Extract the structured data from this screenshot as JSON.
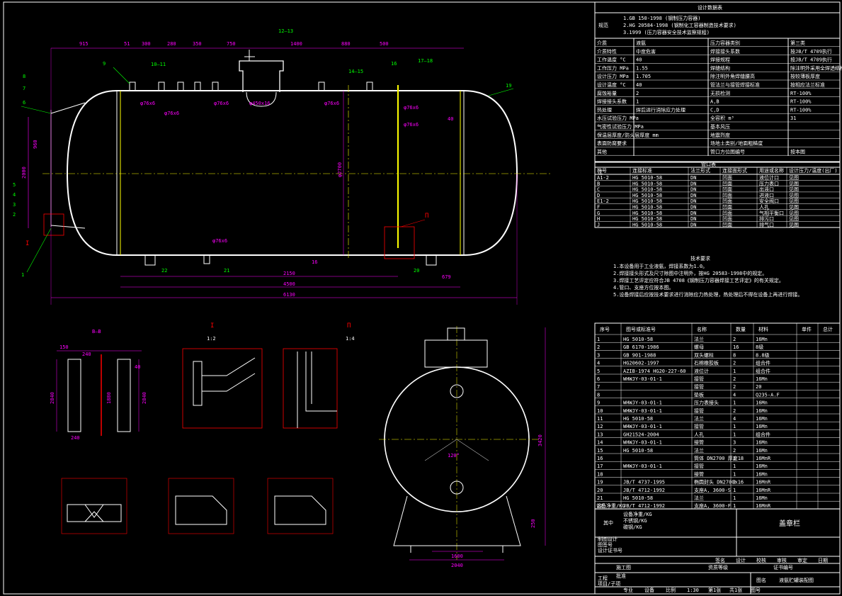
{
  "design_data": {
    "title": "设计数据表",
    "spec_label": "规范",
    "specs": [
      "1.GB 150-1998 (钢制压力容器)",
      "2.HG 20584-1998 (钢制化工容器制造技术要求)",
      "3.1999 (压力容器安全技术监察规程)"
    ],
    "rows": [
      [
        "介质",
        "液氨",
        "压力容器类别",
        "第三类"
      ],
      [
        "介质特性",
        "中度危害",
        "焊接接头系数",
        "按JB/T 4709执行"
      ],
      [
        "工作温度 °C",
        "40",
        "焊接规程",
        "按JB/T 4709执行"
      ],
      [
        "工作压力 MPa",
        "1.55",
        "焊缝结构",
        "除注明外采用全焊透结构"
      ],
      [
        "设计压力 MPa",
        "1.705",
        "除注明外角焊缝腰高",
        "按较薄板厚度"
      ],
      [
        "设计温度 °C",
        "40",
        "管法兰与接管焊接标准",
        "按相应法兰标准"
      ],
      [
        "腐蚀裕量",
        "2",
        "无损检测",
        "RT-100%"
      ],
      [
        "焊接接头系数",
        "1",
        "A,B",
        "RT-100%"
      ],
      [
        "热处理",
        "焊后进行消除应力处理",
        "C,D",
        "RT-100%"
      ],
      [
        "水压试验压力 MPa",
        "",
        "全容积 m³",
        "31"
      ],
      [
        "气密性试验压力 MPa",
        "",
        "基本风压",
        ""
      ],
      [
        "保温层厚度/防火层厚度 mm",
        "",
        "地震烈度",
        ""
      ],
      [
        "表面防腐要求",
        "",
        "场地土类别/地面粗糙度",
        ""
      ],
      [
        "其他",
        "",
        "管口方位图编号",
        "按本图"
      ]
    ]
  },
  "note_label": "注",
  "nozzle_table": {
    "title": "管口表",
    "headers": [
      "符号",
      "连接标准",
      "法兰形式",
      "连接面形式",
      "用途或名称",
      "设计压力/温度(出厂)"
    ],
    "rows": [
      [
        "A1-2",
        "HG 5010-58",
        "DN",
        "凹面",
        "液位计口",
        "见图"
      ],
      [
        "B",
        "HG 5010-58",
        "DN",
        "凹面",
        "压力表口",
        "见图"
      ],
      [
        "C",
        "HG 5010-58",
        "DN",
        "凹面",
        "出液口",
        "见图"
      ],
      [
        "D",
        "HG 5010-58",
        "DN",
        "凹面",
        "进液口",
        "见图"
      ],
      [
        "E1-2",
        "HG 5010-58",
        "DN",
        "凹面",
        "安全阀口",
        "见图"
      ],
      [
        "F",
        "HG 5010-58",
        "DN",
        "凹面",
        "人孔",
        "见图"
      ],
      [
        "G",
        "HG 5010-58",
        "DN",
        "凹面",
        "气相平衡口",
        "见图"
      ],
      [
        "H",
        "HG 5010-58",
        "DN",
        "凹面",
        "排污口",
        "见图"
      ],
      [
        "J",
        "HG 5010-58",
        "DN",
        "凹面",
        "排气口",
        "见图"
      ]
    ]
  },
  "tech_req": {
    "title": "技术要求",
    "items": [
      "1.本设备用于工业液氨，焊接系数为1.0。",
      "2.焊接接头形式及尺寸除图中注明外，按HG 20583-1998中的规定。",
      "3.焊接工艺评定应符合JB 4708《钢制压力容器焊接工艺评定》的有关规定。",
      "4.管口、支座方位按本图。",
      "5.设备焊接后应按技术要求进行消除应力热处理，热处理后不得在设备上再进行焊接。"
    ]
  },
  "parts_table": {
    "headers": [
      "序号",
      "图号或标准号",
      "名称",
      "数量",
      "材料",
      "单件",
      "总计"
    ],
    "rows": [
      [
        "1",
        "HG 5010-58",
        "法兰",
        "2",
        "16Mn",
        "",
        ""
      ],
      [
        "2",
        "GB 6170-1986",
        "螺母",
        "16",
        "8级",
        "",
        ""
      ],
      [
        "3",
        "GB 901-1988",
        "双头螺柱",
        "8",
        "8.8级",
        "",
        ""
      ],
      [
        "4",
        "HG20602-1997",
        "石棉橡胶板",
        "2",
        "组合件",
        "",
        ""
      ],
      [
        "5",
        "AZIB-1974 HG20-227-60",
        "液位计",
        "1",
        "组合件",
        "",
        ""
      ],
      [
        "6",
        "WHWJY-03-01-1",
        "接管",
        "2",
        "16Mn",
        "",
        ""
      ],
      [
        "7",
        "",
        "接管",
        "2",
        "20",
        "",
        ""
      ],
      [
        "8",
        "",
        "垫板",
        "4",
        "Q235-A.F",
        "",
        ""
      ],
      [
        "9",
        "WHWJY-03-01-1",
        "压力表接头",
        "1",
        "16Mn",
        "",
        ""
      ],
      [
        "10",
        "WHWJY-03-01-1",
        "接管",
        "2",
        "16Mn",
        "",
        ""
      ],
      [
        "11",
        "HG 5010-58",
        "法兰",
        "4",
        "16Mn",
        "",
        ""
      ],
      [
        "12",
        "WHWJY-03-01-1",
        "接管",
        "1",
        "16Mn",
        "",
        ""
      ],
      [
        "13",
        "GH21524-2004",
        "人孔",
        "1",
        "组合件",
        "",
        ""
      ],
      [
        "14",
        "WHWJY-03-01-1",
        "接管",
        "3",
        "16Mn",
        "",
        ""
      ],
      [
        "15",
        "HG 5010-58",
        "法兰",
        "2",
        "16Mn",
        "",
        ""
      ],
      [
        "16",
        "",
        "筒体 DN2700 厚度18",
        "1",
        "16MnR",
        "",
        ""
      ],
      [
        "17",
        "WHWJY-03-01-1",
        "接管",
        "1",
        "16Mn",
        "",
        ""
      ],
      [
        "18",
        "",
        "接管",
        "1",
        "16Mn",
        "",
        ""
      ],
      [
        "19",
        "JB/T 4737-1995",
        "椭圆封头 DN2700x16",
        "2",
        "16MnR",
        "",
        ""
      ],
      [
        "20",
        "JB/T 4712-1992",
        "支座A, 3600-S",
        "1",
        "16MnR",
        "",
        ""
      ],
      [
        "21",
        "HG 5010-58",
        "法兰",
        "1",
        "16Mn",
        "",
        ""
      ],
      [
        "22",
        "JB/T 4712-1992",
        "支座A, 3600-F",
        "1",
        "16MnR",
        "",
        ""
      ]
    ]
  },
  "title_block": {
    "weight_label": "设备净重/KG",
    "weight_rows": [
      "设备净重/KG",
      "不锈钢/KG",
      "碳钢/KG"
    ],
    "among_label": "其中",
    "stamp": "盖章栏",
    "left_rows": [
      "制图设计",
      "图签号",
      "设计证书号"
    ],
    "sign_headers": [
      "签名",
      "设计",
      "校核",
      "审核",
      "审定",
      "日期"
    ],
    "company": "施工图",
    "approve": "批准",
    "project_stage": "资质等级",
    "cert_no": "证书编号",
    "name_label": "图名",
    "drawing_name": "液氨贮罐装配图",
    "project_label": "工程",
    "project_no": "项目/子项",
    "bottom": [
      "专业",
      "设备",
      "比例",
      "1:30",
      "第1张",
      "共1张",
      "图号"
    ]
  },
  "dims": {
    "top": [
      "915",
      "51",
      "300",
      "280",
      "350",
      "750",
      "1400",
      "880",
      "500"
    ],
    "d2150": "2150",
    "d4500": "4500",
    "d6130": "6130",
    "d960": "960",
    "d2000": "2000",
    "d2700": "φ2700",
    "d450": "φ450x16",
    "d76": "φ76x6",
    "d40": "40",
    "d679": "679",
    "d16": "16",
    "d3420": "3420",
    "d1600": "1600",
    "d2040": "2040",
    "d250": "250",
    "a120": "120°"
  },
  "callouts": [
    "1",
    "2",
    "3",
    "4",
    "5",
    "6",
    "7",
    "8",
    "9",
    "10—11",
    "12—13",
    "14—15",
    "16",
    "17—18",
    "19",
    "20",
    "21",
    "22"
  ],
  "section_labels": {
    "bb": "B—B",
    "i": "I",
    "i_scale": "1:2",
    "ii": "П",
    "ii_scale": "1:4",
    "ii_tag": "П",
    "i_tag": "I",
    "bb_dims": [
      "150",
      "240",
      "40",
      "2840",
      "1880",
      "2840",
      "240"
    ]
  }
}
